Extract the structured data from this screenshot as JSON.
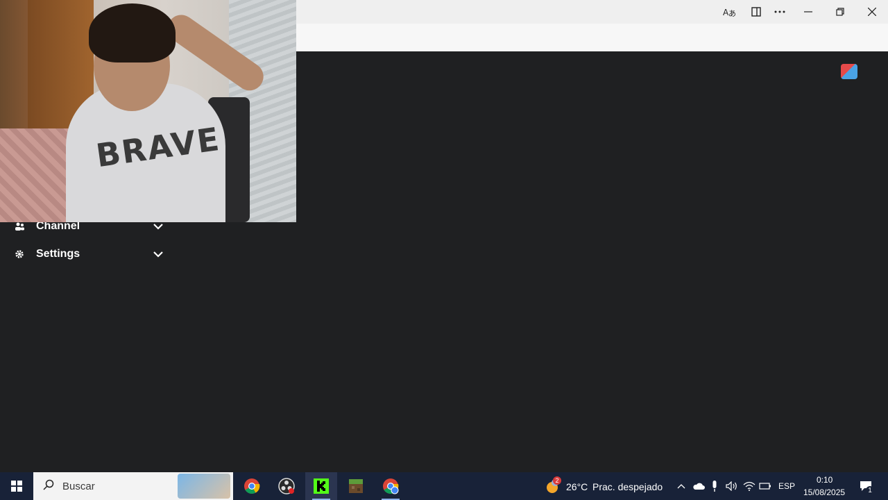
{
  "menu": {
    "items": [
      {
        "label": "Channel",
        "icon": "channel-icon"
      },
      {
        "label": "Settings",
        "icon": "gear-icon"
      }
    ]
  },
  "webcam": {
    "shirt_text": "BRAVE"
  },
  "taskbar": {
    "search_placeholder": "Buscar",
    "weather_temp": "26°C",
    "weather_text": "Prac. despejado",
    "weather_badge": "2",
    "language": "ESP",
    "time": "0:10",
    "date": "15/08/2025",
    "notification_count": "1"
  },
  "colors": {
    "content_bg": "#1f2022",
    "taskbar_bg": "#182238",
    "titlebar_bg": "#efefef"
  }
}
